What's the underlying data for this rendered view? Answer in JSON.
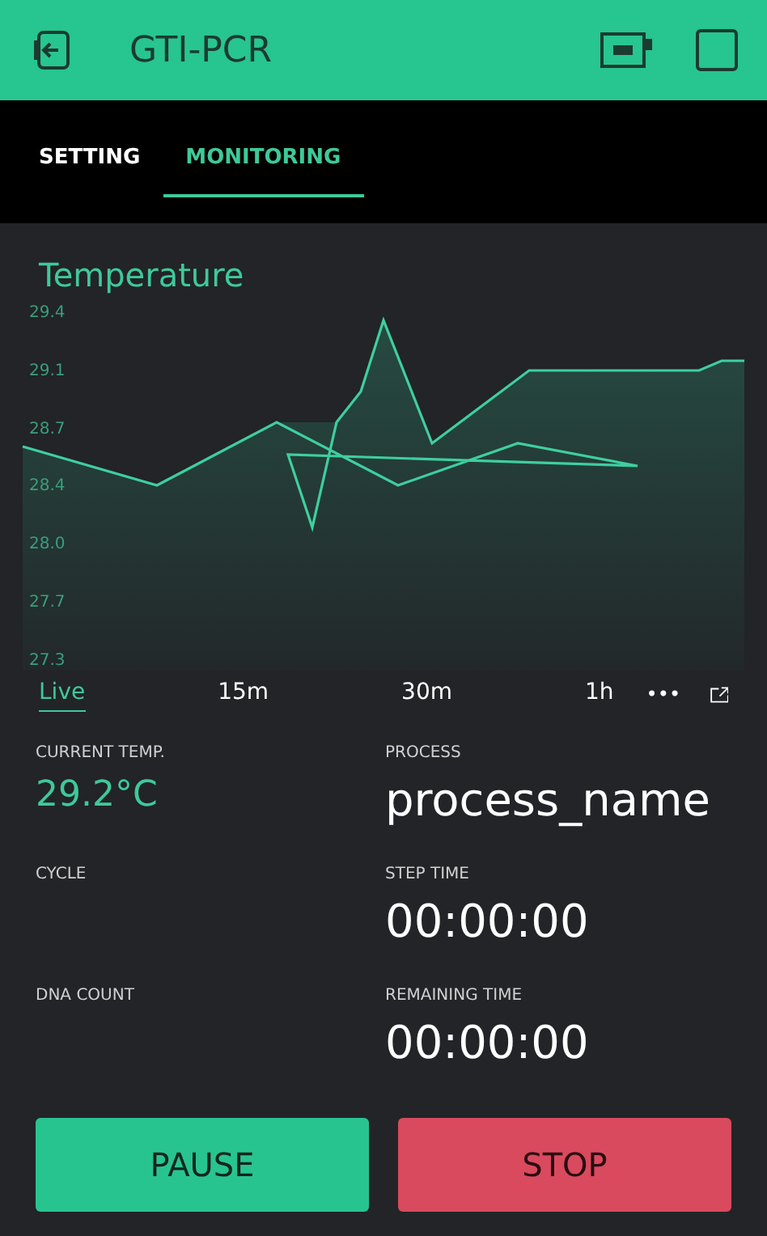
{
  "header": {
    "title": "GTI-PCR"
  },
  "tabs": [
    {
      "label": "SETTING",
      "selected": false
    },
    {
      "label": "MONITORING",
      "selected": true
    }
  ],
  "chart": {
    "title": "Temperature",
    "y_labels": [
      "29.4",
      "29.1",
      "28.7",
      "28.4",
      "28.0",
      "27.7",
      "27.3"
    ],
    "ranges": [
      {
        "label": "Live",
        "selected": true
      },
      {
        "label": "15m",
        "selected": false
      },
      {
        "label": "30m",
        "selected": false
      },
      {
        "label": "1h",
        "selected": false
      }
    ],
    "more": "•••"
  },
  "fields": [
    {
      "label": "CURRENT TEMP.",
      "value": "29.2°C",
      "kind": "accent"
    },
    {
      "label": "PROCESS",
      "value": "process_name",
      "kind": "plain"
    },
    {
      "label": "CYCLE"
    },
    {
      "label": "STEP TIME",
      "value": "00:00:00",
      "kind": "plain"
    },
    {
      "label": "DNA COUNT"
    },
    {
      "label": "REMAINING TIME",
      "value": "00:00:00",
      "kind": "plain"
    }
  ],
  "buttons": [
    {
      "label": "PAUSE",
      "kind": "primary"
    },
    {
      "label": "STOP",
      "kind": "danger"
    }
  ]
}
